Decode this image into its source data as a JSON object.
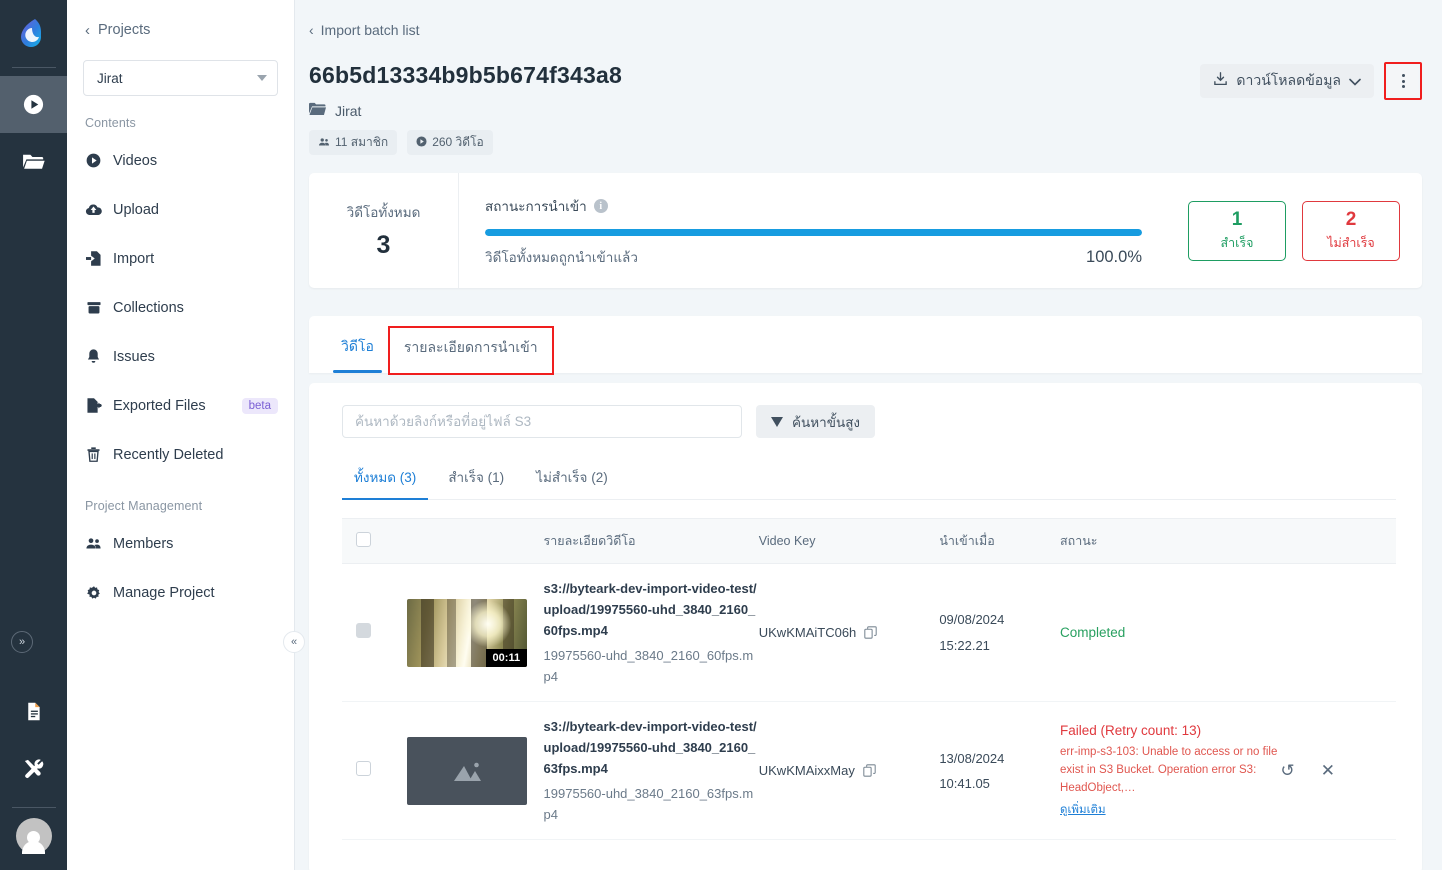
{
  "rail": {
    "logo_icon": "byteark-logo-icon",
    "items": [
      {
        "icon": "play-circle-icon",
        "name": "videos",
        "active": true
      },
      {
        "icon": "folder-open-icon",
        "name": "projects",
        "active": false
      }
    ],
    "bottom_items": [
      {
        "icon": "document-icon",
        "name": "docs"
      },
      {
        "icon": "tools-icon",
        "name": "tools"
      }
    ],
    "avatar_icon": "user-avatar-icon",
    "expand_icon": "»"
  },
  "sidebar": {
    "back_label": "Projects",
    "back_icon": "chevron-left-icon",
    "project_selected": "Jirat",
    "section_contents": "Contents",
    "section_project_management": "Project Management",
    "collapse_icon": "«",
    "items": [
      {
        "label": "Videos",
        "icon": "play-circle-icon",
        "badge": ""
      },
      {
        "label": "Upload",
        "icon": "cloud-upload-icon",
        "badge": ""
      },
      {
        "label": "Import",
        "icon": "file-import-icon",
        "badge": ""
      },
      {
        "label": "Collections",
        "icon": "archive-icon",
        "badge": ""
      },
      {
        "label": "Issues",
        "icon": "bell-icon",
        "badge": ""
      },
      {
        "label": "Exported Files",
        "icon": "file-export-icon",
        "badge": "beta"
      },
      {
        "label": "Recently Deleted",
        "icon": "trash-icon",
        "badge": ""
      }
    ],
    "management_items": [
      {
        "label": "Members",
        "icon": "users-icon"
      },
      {
        "label": "Manage Project",
        "icon": "gear-icon"
      }
    ]
  },
  "header": {
    "breadcrumb": "Import batch list",
    "breadcrumb_icon": "chevron-left-icon",
    "title": "66b5d13334b9b5b674f343a8",
    "folder_icon": "folder-icon",
    "folder_name": "Jirat",
    "chips": [
      {
        "icon": "users-icon",
        "label": "11 สมาชิก"
      },
      {
        "icon": "video-icon",
        "label": "260 วิดีโอ"
      }
    ],
    "download_label": "ดาวน์โหลดข้อมูล",
    "download_icon": "download-icon",
    "download_caret": "chevron-down-icon",
    "kebab_icon": "more-vertical-icon"
  },
  "stats": {
    "total_label": "วิดีโอทั้งหมด",
    "total_value": "3",
    "progress_label": "สถานะการนำเข้า",
    "info_icon": "info-icon",
    "progress_note": "วิดีโอทั้งหมดถูกนำเข้าแล้ว",
    "progress_percent_text": "100.0%",
    "progress_percent": 100,
    "success_count": "1",
    "success_label": "สำเร็จ",
    "success_color": "#1e9d62",
    "fail_count": "2",
    "fail_label": "ไม่สำเร็จ",
    "fail_color": "#e0393e"
  },
  "tabs": [
    {
      "label": "วิดีโอ",
      "active": true,
      "highlighted": false
    },
    {
      "label": "รายละเอียดการนำเข้า",
      "active": false,
      "highlighted": true
    }
  ],
  "search": {
    "value": "",
    "placeholder": "ค้นหาด้วยลิงก์หรือที่อยู่ไฟล์ S3",
    "advanced_label": "ค้นหาขั้นสูง",
    "filter_icon": "funnel-icon"
  },
  "filter_tabs": [
    {
      "label": "ทั้งหมด (3)",
      "active": true
    },
    {
      "label": "สำเร็จ (1)",
      "active": false
    },
    {
      "label": "ไม่สำเร็จ (2)",
      "active": false
    }
  ],
  "table": {
    "headers": {
      "checkbox": "",
      "thumbnail": "",
      "detail": "รายละเอียดวิดีโอ",
      "video_key": "Video Key",
      "imported_at": "นำเข้าเมื่อ",
      "status": "สถานะ",
      "actions": ""
    },
    "rows": [
      {
        "checkbox_state": "disabled",
        "thumbnail_type": "image",
        "duration": "00:11",
        "detail_path": "s3://byteark-dev-import-video-test/upload/19975560-uhd_3840_2160_60fps.mp4",
        "detail_file": "19975560-uhd_3840_2160_60fps.mp4",
        "video_key": "UKwKMAiTC06h",
        "copy_icon": "copy-icon",
        "date": "09/08/2024",
        "time": "15:22.21",
        "status_type": "completed",
        "status_label": "Completed",
        "error_message": "",
        "more_label": "",
        "actions": []
      },
      {
        "checkbox_state": "unchecked",
        "thumbnail_type": "placeholder",
        "duration": "",
        "detail_path": "s3://byteark-dev-import-video-test/upload/19975560-uhd_3840_2160_63fps.mp4",
        "detail_file": "19975560-uhd_3840_2160_63fps.mp4",
        "video_key": "UKwKMAixxMay",
        "copy_icon": "copy-icon",
        "date": "13/08/2024",
        "time": "10:41.05",
        "status_type": "failed",
        "status_label": "Failed (Retry count: 13)",
        "error_message": "err-imp-s3-103: Unable to access or no file exist in S3 Bucket. Operation error S3: HeadObject,…",
        "more_label": "ดูเพิ่มเติม",
        "actions": [
          {
            "icon": "retry-icon",
            "glyph": "↺"
          },
          {
            "icon": "close-icon",
            "glyph": "✕"
          }
        ]
      }
    ]
  },
  "colors": {
    "rail_bg": "#25333f",
    "rail_active": "#53606d",
    "accent_blue": "#1e7fd6",
    "progress_blue": "#179ce0",
    "page_bg": "#f2f6f9",
    "highlight_red": "#f01e1e"
  }
}
